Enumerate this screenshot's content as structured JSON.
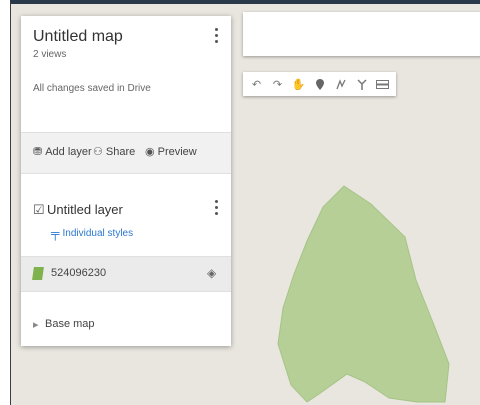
{
  "map": {
    "title": "Untitled map",
    "views": "2 views",
    "save_status": "All changes saved in Drive"
  },
  "actions": {
    "add_layer": "Add layer",
    "share": "Share",
    "preview": "Preview"
  },
  "layer": {
    "name": "Untitled layer",
    "styles": "Individual styles",
    "feature_label": "524096230"
  },
  "base_map": {
    "label": "Base map"
  },
  "toolbar": {
    "icons": [
      "undo-icon",
      "redo-icon",
      "hand-icon",
      "marker-icon",
      "draw-line-icon",
      "directions-icon",
      "measure-ruler-icon"
    ]
  },
  "colors": {
    "map_background": "#e9e6df",
    "polygon_fill": "#b5cf96",
    "accent_link": "#2a77d0",
    "frame_top": "#2b3a4a"
  }
}
